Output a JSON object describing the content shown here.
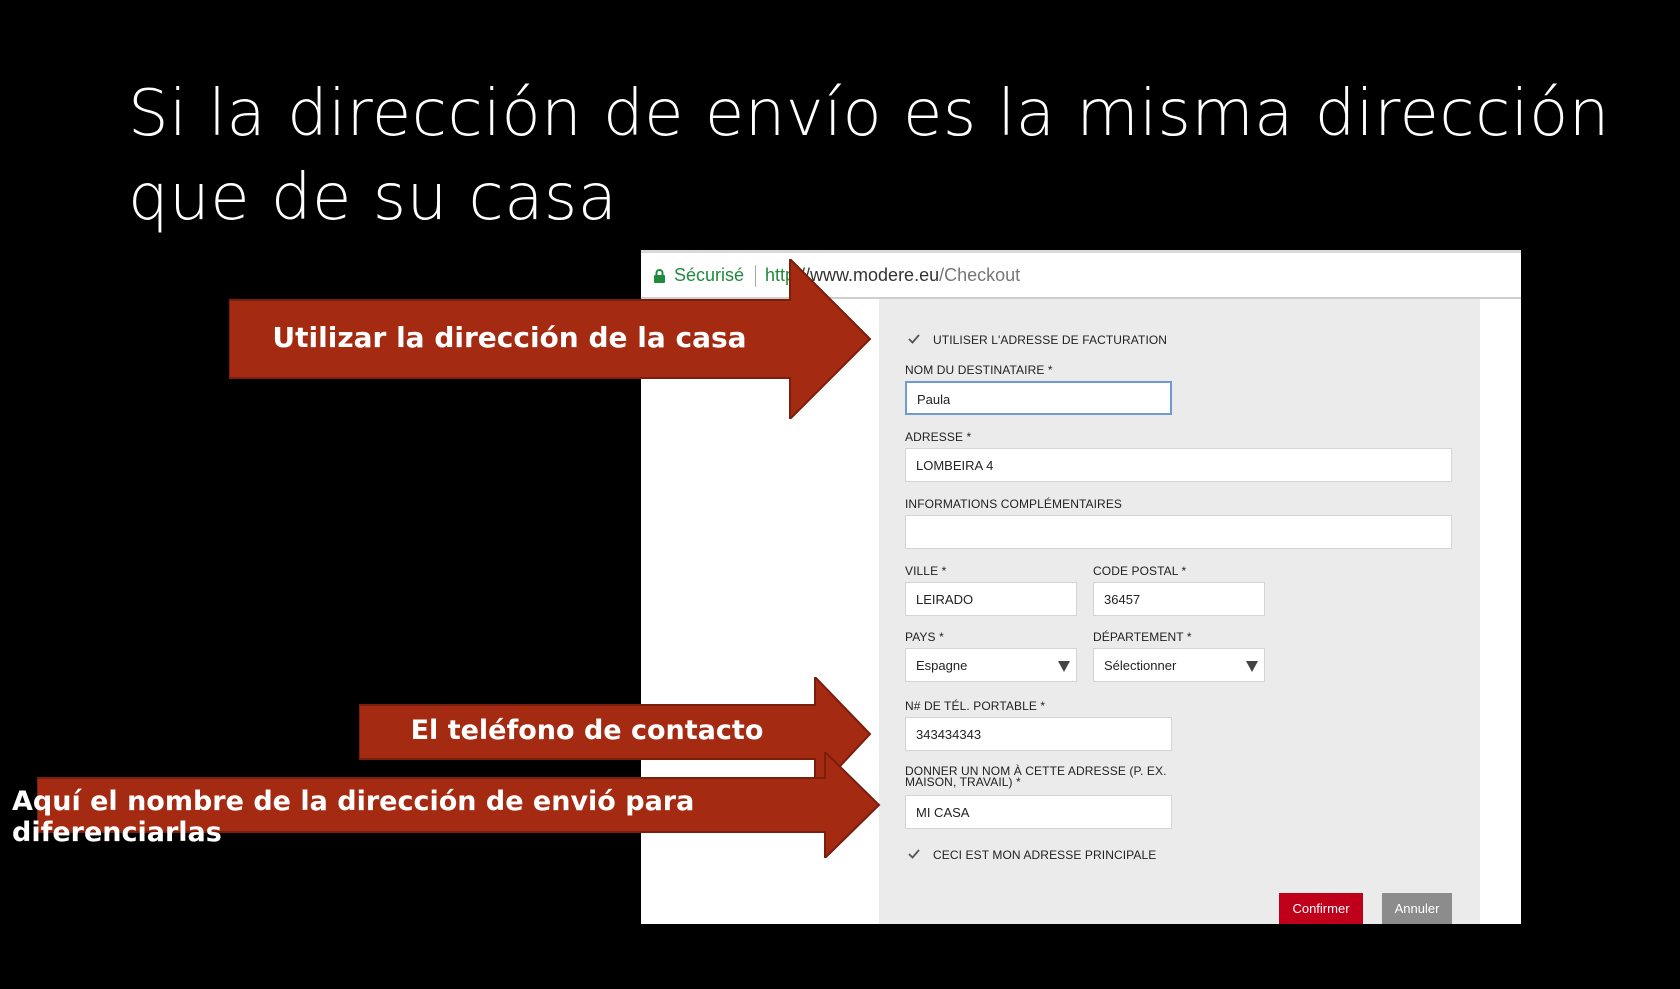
{
  "slide": {
    "title_line1": "Si la dirección de envío  es la misma dirección",
    "title_line2": "que de su casa"
  },
  "browser": {
    "secure_label": "Sécurisé",
    "url_scheme": "http",
    "url_host": "://www.modere.eu",
    "url_path": "/Checkout"
  },
  "form": {
    "use_billing_label": "UTILISER L'ADRESSE DE FACTURATION",
    "use_billing_checked": true,
    "recipient_label": "NOM DU DESTINATAIRE *",
    "recipient_value": "Paula",
    "address_label": "ADRESSE *",
    "address_value": "LOMBEIRA 4",
    "extra_label": "INFORMATIONS COMPLÉMENTAIRES",
    "extra_value": "",
    "city_label": "VILLE *",
    "city_value": "LEIRADO",
    "zip_label": "CODE POSTAL *",
    "zip_value": "36457",
    "country_label": "PAYS *",
    "country_value": "Espagne",
    "dept_label": "DÉPARTEMENT *",
    "dept_value": "Sélectionner",
    "phone_label": "N# DE TÉL. PORTABLE *",
    "phone_value": "343434343",
    "addr_name_label": "DONNER UN NOM À CETTE ADRESSE (P. EX. MAISON, TRAVAIL) *",
    "addr_name_value": "MI CASA",
    "main_addr_label": "CECI EST MON ADRESSE PRINCIPALE",
    "main_addr_checked": true,
    "confirm_label": "Confirmer",
    "cancel_label": "Annuler"
  },
  "annotations": {
    "arrow1_text": "Utilizar la dirección de la casa",
    "arrow2_text": "El teléfono de contacto",
    "arrow3_text": "Aquí el nombre de la dirección de envió para diferenciarlas"
  },
  "colors": {
    "arrow_fill": "#a52a12",
    "arrow_stroke": "#7a1e0d",
    "confirm_button": "#c0001a",
    "secure_green": "#1e8a3c"
  }
}
